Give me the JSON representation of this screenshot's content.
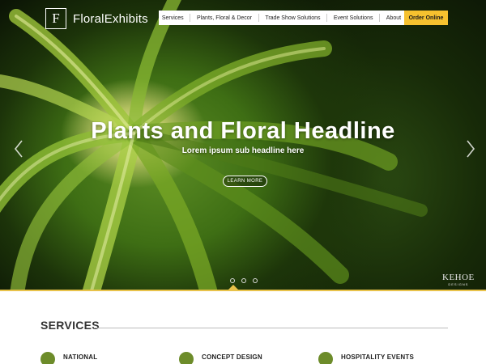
{
  "brand": {
    "logo_letter": "F",
    "name": "FloralExhibits"
  },
  "nav": {
    "items": [
      {
        "label": "Services"
      },
      {
        "label": "Plants, Floral & Decor"
      },
      {
        "label": "Trade Show Solutions"
      },
      {
        "label": "Event Solutions"
      },
      {
        "label": "About"
      }
    ],
    "order_label": "Order Online"
  },
  "hero": {
    "headline": "Plants and Floral Headline",
    "subheadline": "Lorem ipsum sub headline here",
    "cta_label": "LEARN MORE",
    "slide_count": 3,
    "credit_main": "KEHOE",
    "credit_sub": "DESIGNS"
  },
  "services": {
    "title": "SERVICES",
    "items": [
      {
        "label": "NATIONAL"
      },
      {
        "label": "CONCEPT DESIGN"
      },
      {
        "label": "HOSPITALITY EVENTS"
      }
    ]
  },
  "colors": {
    "accent": "#f6c12f",
    "service_icon": "#6d8c2a",
    "gold_bar": "#e8c24a"
  },
  "icons": {
    "prev": "chevron-left-icon",
    "next": "chevron-right-icon"
  }
}
